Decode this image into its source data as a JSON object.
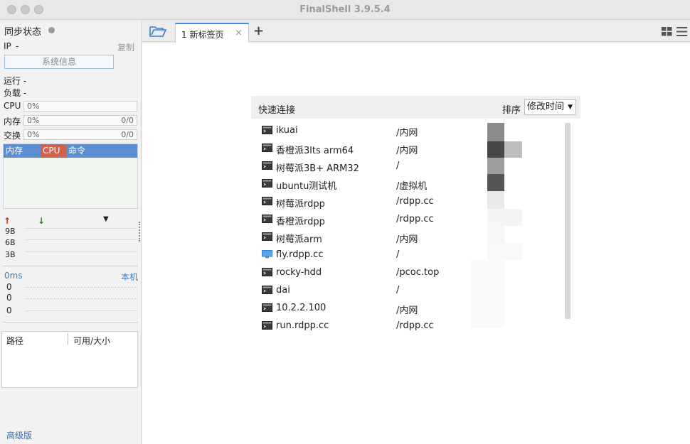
{
  "window": {
    "title": "FinalShell 3.9.5.4"
  },
  "sidebar": {
    "sync_title": "同步状态",
    "ip_label": "IP",
    "ip_value": "-",
    "copy": "复制",
    "sysinfo_button": "系统信息",
    "run_label": "运行 -",
    "load_label": "负载 -",
    "cpu": {
      "label": "CPU",
      "value": "0%"
    },
    "mem": {
      "label": "内存",
      "value": "0%",
      "ratio": "0/0"
    },
    "swap": {
      "label": "交换",
      "value": "0%",
      "ratio": "0/0"
    },
    "proc_headers": {
      "mem": "内存",
      "cpu": "CPU",
      "cmd": "命令"
    },
    "net": {
      "rows": [
        "9B",
        "6B",
        "3B"
      ]
    },
    "ping": {
      "ms": "0ms",
      "host": "本机",
      "rows": [
        "0",
        "0",
        "0"
      ]
    },
    "disk": {
      "col_path": "路径",
      "col_avail": "可用/大小"
    },
    "advanced": "高级版"
  },
  "tabs": [
    {
      "label": "1 新标签页"
    }
  ],
  "quick_connect": {
    "title": "快速连接",
    "sort_label": "排序",
    "sort_value": "修改时间",
    "connections": [
      {
        "name": "ikuai",
        "group": "/内网",
        "icon": "terminal-icon"
      },
      {
        "name": "香橙派3lts arm64",
        "group": "/内网",
        "icon": "terminal-icon"
      },
      {
        "name": "树莓派3B+ ARM32",
        "group": "/",
        "icon": "terminal-icon"
      },
      {
        "name": "ubuntu测试机",
        "group": "/虚拟机",
        "icon": "terminal-icon"
      },
      {
        "name": "树莓派rdpp",
        "group": "/rdpp.cc",
        "icon": "terminal-icon"
      },
      {
        "name": "香橙派rdpp",
        "group": "/rdpp.cc",
        "icon": "terminal-icon"
      },
      {
        "name": "树莓派arm",
        "group": "/内网",
        "icon": "terminal-icon"
      },
      {
        "name": "fly.rdpp.cc",
        "group": "/",
        "icon": "monitor-icon"
      },
      {
        "name": "rocky-hdd",
        "group": "/pcoc.top",
        "icon": "terminal-icon"
      },
      {
        "name": "dai",
        "group": "/",
        "icon": "terminal-icon"
      },
      {
        "name": "10.2.2.100",
        "group": "/内网",
        "icon": "terminal-icon"
      },
      {
        "name": "run.rdpp.cc",
        "group": "/rdpp.cc",
        "icon": "terminal-icon"
      }
    ]
  },
  "colors": {
    "accent": "#3a8ee6",
    "proc_header": "#5b8fd1",
    "cpu_header": "#d2604d"
  }
}
